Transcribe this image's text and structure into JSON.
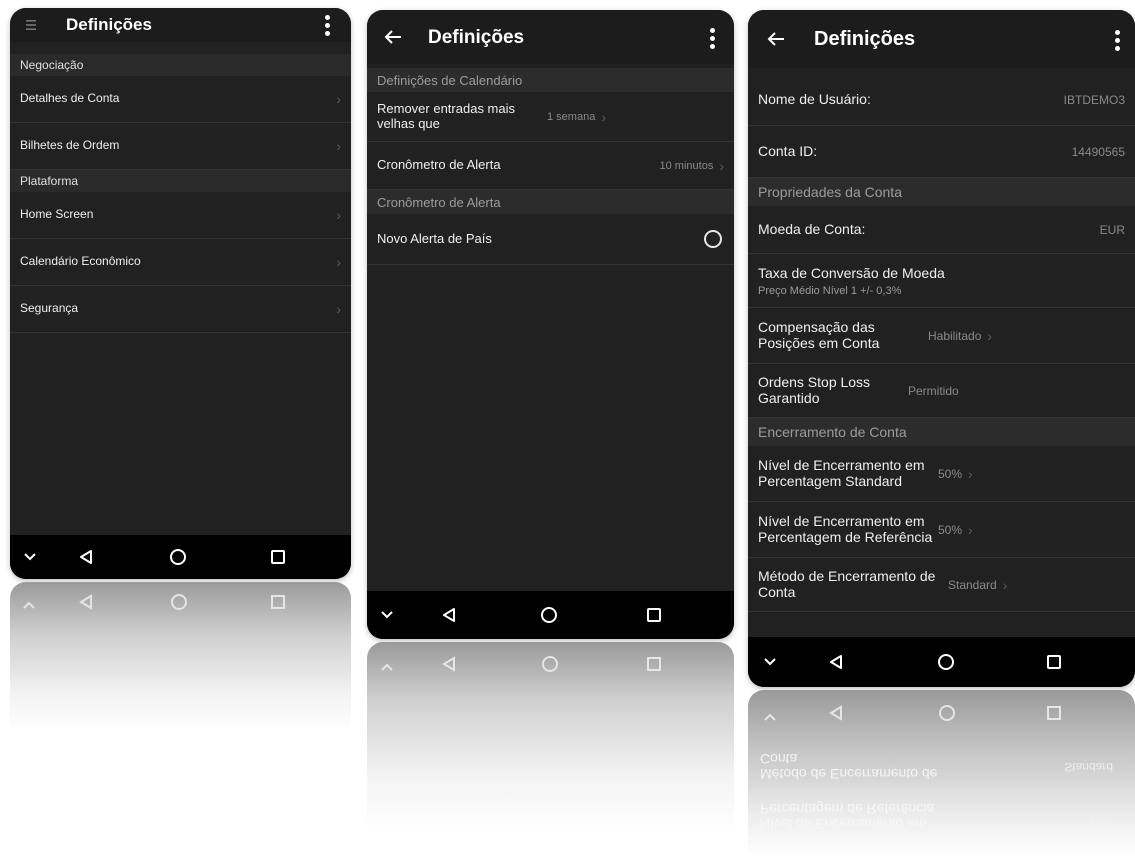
{
  "colors": {
    "surface": "#212121",
    "appbar": "#1c1c1c",
    "section": "#2c2c2c",
    "navbar": "#000000",
    "text": "#efefef",
    "muted": "#8a8a8a"
  },
  "nav_icons": [
    "chevron-down-icon",
    "back-triangle-icon",
    "home-circle-icon",
    "recents-square-icon"
  ],
  "screen1": {
    "title": "Definições",
    "sections": [
      {
        "header": "Negociação",
        "items": [
          {
            "label": "Detalhes de Conta"
          },
          {
            "label": "Bilhetes de Ordem"
          }
        ]
      },
      {
        "header": "Plataforma",
        "items": [
          {
            "label": "Home Screen"
          },
          {
            "label": "Calendário Econômico"
          },
          {
            "label": "Segurança"
          }
        ]
      }
    ]
  },
  "screen2": {
    "title": "Definições",
    "section1": "Definições de Calendário",
    "remove_label": "Remover entradas mais velhas que",
    "remove_value": "1 semana",
    "timer_label": "Cronômetro de Alerta",
    "timer_value": "10 minutos",
    "section2": "Cronômetro de Alerta",
    "country_alert_label": "Novo Alerta de País",
    "country_alert_checked": false
  },
  "screen3": {
    "title": "Definições",
    "username_label": "Nome de Usuário:",
    "username_value": "IBTDEMO3",
    "account_id_label": "Conta ID:",
    "account_id_value": "14490565",
    "section_props": "Propriedades da Conta",
    "currency_label": "Moeda de Conta:",
    "currency_value": "EUR",
    "conversion_label": "Taxa de Conversão de Moeda",
    "conversion_sub": "Preço Médio Nível 1 +/- 0,3%",
    "offset_label": "Compensação das Posições em Conta",
    "offset_value": "Habilitado",
    "gsl_label": "Ordens Stop Loss Garantido",
    "gsl_value": "Permitido",
    "section_closeout": "Encerramento de Conta",
    "closeout_std_label": "Nível de Encerramento em Percentagem Standard",
    "closeout_std_value": "50%",
    "closeout_ref_label": "Nível de Encerramento em Percentagem de Referência",
    "closeout_ref_value": "50%",
    "closeout_method_label": "Método de Encerramento de Conta",
    "closeout_method_value": "Standard"
  }
}
